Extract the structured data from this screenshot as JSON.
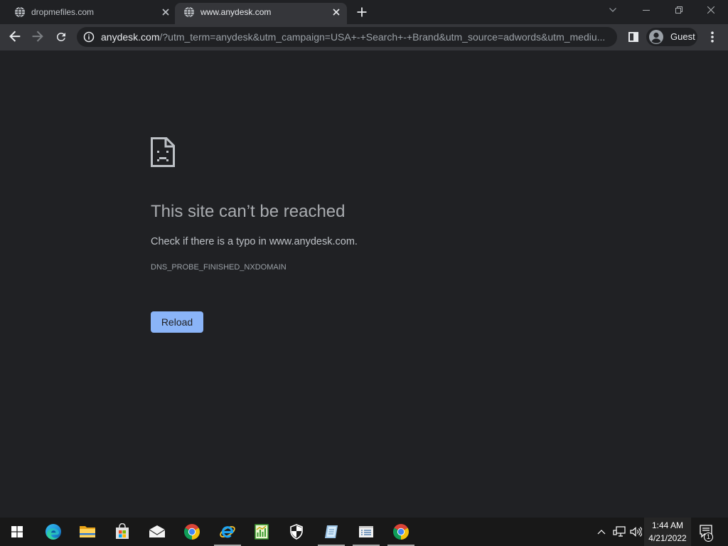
{
  "browser": {
    "tabs": [
      {
        "title": "dropmefiles.com",
        "icon": "globe-icon",
        "active": false
      },
      {
        "title": "www.anydesk.com",
        "icon": "globe-icon",
        "active": true
      }
    ],
    "new_tab_icon": "plus-icon",
    "window_controls": [
      "tab-search-icon",
      "minimize-icon",
      "restore-icon",
      "close-icon"
    ],
    "toolbar_icons": [
      "back-icon",
      "forward-icon",
      "reload-icon",
      "side-panel-icon",
      "menu-icon"
    ],
    "omnibox": {
      "security_icon": "info-icon",
      "host": "anydesk.com",
      "path": "/?utm_term=anydesk&utm_campaign=USA+-+Search+-+Brand&utm_source=adwords&utm_mediu..."
    },
    "profile": {
      "icon": "avatar-icon",
      "label": "Guest"
    }
  },
  "error_page": {
    "icon": "sad-page-icon",
    "heading": "This site can’t be reached",
    "message": "Check if there is a typo in www.anydesk.com.",
    "error_code": "DNS_PROBE_FINISHED_NXDOMAIN",
    "reload_button": "Reload"
  },
  "taskbar": {
    "start_icon": "windows-start-icon",
    "apps": [
      {
        "icon": "edge-icon",
        "running": false
      },
      {
        "icon": "file-explorer-icon",
        "running": false
      },
      {
        "icon": "store-icon",
        "running": false
      },
      {
        "icon": "mail-icon",
        "running": false
      },
      {
        "icon": "chrome-icon",
        "running": false
      },
      {
        "icon": "internet-explorer-icon",
        "running": true
      },
      {
        "icon": "chart-app-icon",
        "running": false
      },
      {
        "icon": "windows-security-icon",
        "running": false
      },
      {
        "icon": "notepad-app-icon",
        "running": true
      },
      {
        "icon": "list-app-icon",
        "running": true
      },
      {
        "icon": "chrome-icon",
        "running": true
      }
    ],
    "tray_icons": [
      "show-hidden-icons-icon",
      "network-icon",
      "volume-icon"
    ],
    "clock": {
      "time": "1:44 AM",
      "date": "4/21/2022"
    },
    "notifications": {
      "icon": "action-center-icon",
      "count": "1"
    }
  },
  "colors": {
    "frame_bg": "#202124",
    "toolbar_bg": "#35363a",
    "page_bg": "#202124",
    "accent": "#8ab4f8",
    "taskbar_bg": "#181818"
  }
}
